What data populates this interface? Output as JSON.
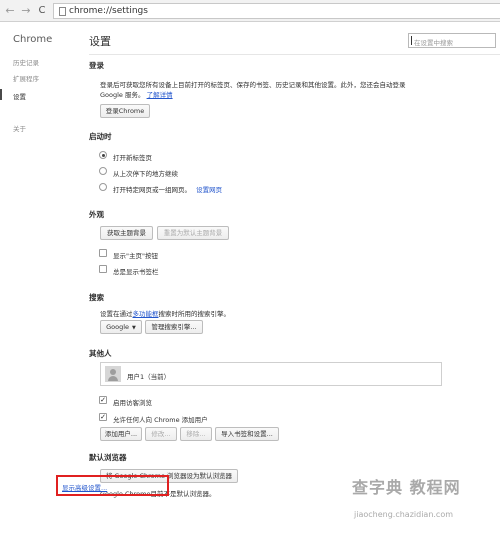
{
  "browser": {
    "url": "chrome://settings"
  },
  "sidebar": {
    "brand": "Chrome",
    "items": [
      {
        "label": "历史记录"
      },
      {
        "label": "扩展程序"
      },
      {
        "label": "设置"
      },
      {
        "label": "关于"
      }
    ]
  },
  "header": {
    "title": "设置",
    "search_placeholder": "在设置中搜索"
  },
  "signin": {
    "title": "登录",
    "desc_line1": "登录后可获取您所有设备上目前打开的标签页、保存的书签、历史记录和其他设置。此外，您还会自动登录",
    "desc_line2": "Google 服务。",
    "learn_more": "了解详情",
    "button": "登录Chrome"
  },
  "startup": {
    "title": "启动时",
    "options": [
      {
        "label": "打开新标签页",
        "selected": true
      },
      {
        "label": "从上次停下的地方继续",
        "selected": false
      },
      {
        "label": "打开特定网页或一组网页。",
        "selected": false
      }
    ],
    "set_pages_link": "设置网页"
  },
  "appearance": {
    "title": "外观",
    "get_themes": "获取主题背景",
    "reset_theme": "重置为默认主题背景",
    "show_home": "显示\"主页\"按钮",
    "show_bookmarks": "总是显示书签栏"
  },
  "search": {
    "title": "搜索",
    "desc_prefix": "设置在通过",
    "desc_link": "多功能框",
    "desc_suffix": "搜索时所用的搜索引擎。",
    "engine": "Google",
    "manage": "管理搜索引擎..."
  },
  "people": {
    "title": "其他人",
    "user": "用户1（当前）",
    "enable_guest": "启用访客浏览",
    "let_anyone_add": "允许任何人向 Chrome 添加用户",
    "add_user": "添加用户...",
    "edit": "修改...",
    "remove": "移除...",
    "import": "导入书签和设置..."
  },
  "default_browser": {
    "title": "默认浏览器",
    "button": "将 Google Chrome 浏览器设为默认浏览器",
    "status": "Google Chrome目前不是默认浏览器。"
  },
  "advanced": {
    "link": "显示高级设置..."
  },
  "watermark": {
    "line1": "查字典 教程网",
    "line2": "jiaocheng.chazidian.com"
  },
  "colors": {
    "link": "#2255cc",
    "highlight_box": "#e02020"
  }
}
